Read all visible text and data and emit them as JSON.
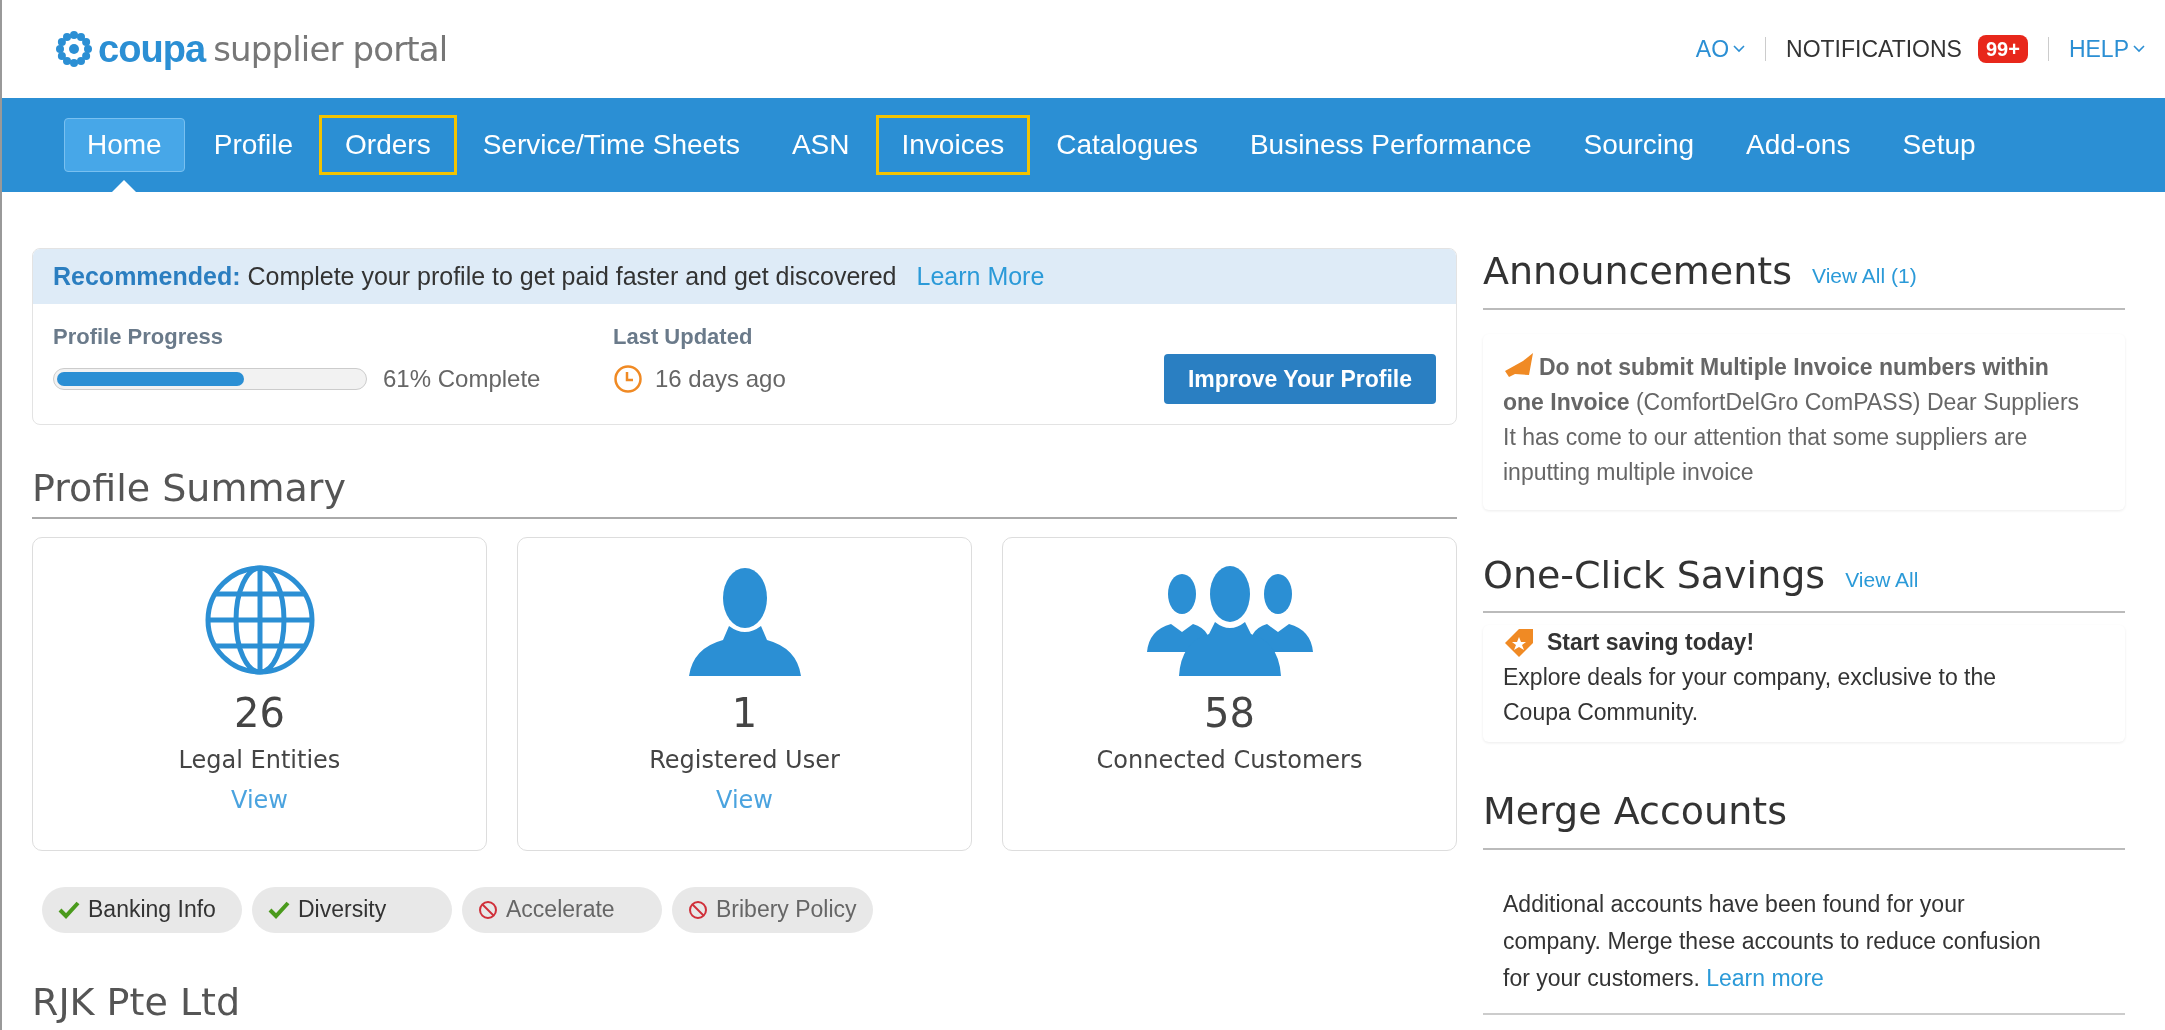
{
  "header": {
    "logo_mark": "coupa",
    "logo_text": "supplier portal",
    "user": "AO",
    "notifications": "NOTIFICATIONS",
    "notifications_badge": "99+",
    "help": "HELP"
  },
  "nav": [
    {
      "label": "Home",
      "selected": true,
      "highlighted": false
    },
    {
      "label": "Profile",
      "selected": false,
      "highlighted": false
    },
    {
      "label": "Orders",
      "selected": false,
      "highlighted": true
    },
    {
      "label": "Service/Time Sheets",
      "selected": false,
      "highlighted": false
    },
    {
      "label": "ASN",
      "selected": false,
      "highlighted": false
    },
    {
      "label": "Invoices",
      "selected": false,
      "highlighted": true
    },
    {
      "label": "Catalogues",
      "selected": false,
      "highlighted": false
    },
    {
      "label": "Business Performance",
      "selected": false,
      "highlighted": false
    },
    {
      "label": "Sourcing",
      "selected": false,
      "highlighted": false
    },
    {
      "label": "Add-ons",
      "selected": false,
      "highlighted": false
    },
    {
      "label": "Setup",
      "selected": false,
      "highlighted": false
    }
  ],
  "recommendation": {
    "label": "Recommended:",
    "text": "Complete your profile to get paid faster and get discovered",
    "link": "Learn More",
    "progress_label": "Profile Progress",
    "level": 0.61,
    "progress_text": "61% Complete",
    "updated_label": "Last Updated",
    "updated_value": "16 days ago",
    "button": "Improve Your Profile"
  },
  "profile_summary": {
    "title": "Profile Summary",
    "cards": [
      {
        "kind": "globe",
        "count": "26",
        "label": "Legal Entities",
        "link": "View"
      },
      {
        "kind": "user",
        "count": "1",
        "label": "Registered User",
        "link": "View"
      },
      {
        "kind": "group",
        "count": "58",
        "label": "Connected Customers"
      }
    ],
    "chips": [
      {
        "label": "Banking Info",
        "kind": "done"
      },
      {
        "label": "Diversity",
        "kind": "done"
      },
      {
        "label": "Accelerate",
        "kind": "missing"
      },
      {
        "label": "Bribery Policy",
        "kind": "missing"
      }
    ]
  },
  "company_title": "RJK Pte Ltd",
  "announcements": {
    "title": "Announcements",
    "link": "View All (1)",
    "headline": "Do not submit Multiple Invoice numbers within one Invoice",
    "source": "(ComfortDelGro ComPASS)",
    "body": "Dear Suppliers   It has come to our attention that some suppliers are inputting multiple invoice"
  },
  "savings": {
    "title": "One-Click Savings",
    "link": "View All",
    "headline": "Start saving today!",
    "body": "Explore deals for your company, exclusive to the Coupa Community."
  },
  "merge": {
    "title": "Merge Accounts",
    "body": "Additional accounts have been found for your company. Merge these accounts to reduce confusion for your customers.",
    "link": "Learn more"
  }
}
